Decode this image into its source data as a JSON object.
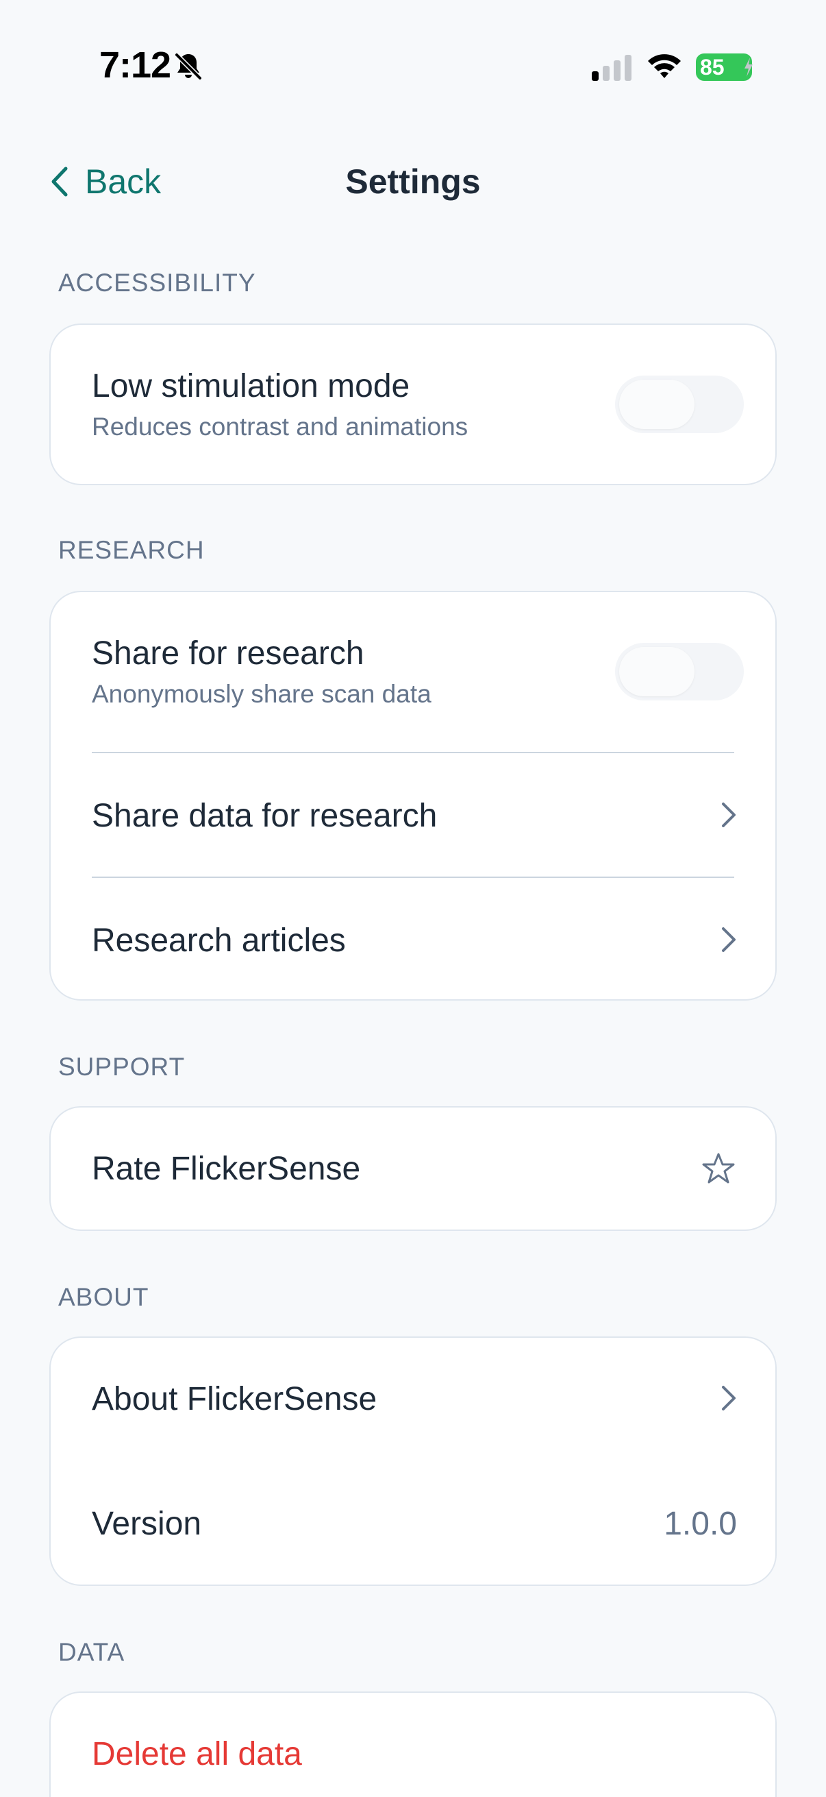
{
  "status_bar": {
    "time": "7:12",
    "battery": "85",
    "icons": [
      "bell-slash-icon",
      "cellular-signal-icon",
      "wifi-icon",
      "battery-charging-icon"
    ],
    "battery_color": "#34c759"
  },
  "nav": {
    "back_label": "Back",
    "title": "Settings",
    "accent_color": "#0f766e"
  },
  "sections": {
    "accessibility": {
      "header": "ACCESSIBILITY",
      "low_stim": {
        "title": "Low stimulation mode",
        "subtitle": "Reduces contrast and animations",
        "enabled": false
      }
    },
    "research": {
      "header": "RESEARCH",
      "share_toggle": {
        "title": "Share for research",
        "subtitle": "Anonymously share scan data",
        "enabled": false
      },
      "share_data_label": "Share data for research",
      "articles_label": "Research articles"
    },
    "support": {
      "header": "SUPPORT",
      "rate_label": "Rate FlickerSense"
    },
    "about": {
      "header": "ABOUT",
      "about_label": "About FlickerSense",
      "version_label": "Version",
      "version_value": "1.0.0"
    },
    "data": {
      "header": "DATA",
      "delete_label": "Delete all data",
      "danger_color": "#e53935"
    }
  }
}
